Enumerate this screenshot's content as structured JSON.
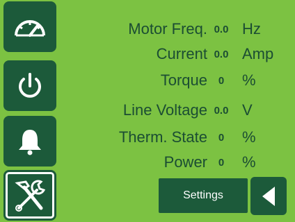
{
  "sidebar": {
    "items": [
      {
        "icon": "speedometer-icon"
      },
      {
        "icon": "power-icon"
      },
      {
        "icon": "bell-icon"
      },
      {
        "icon": "tools-icon",
        "selected": true
      }
    ]
  },
  "readings": [
    {
      "label": "Motor Freq.",
      "value": "0.0",
      "unit": "Hz"
    },
    {
      "label": "Current",
      "value": "0.0",
      "unit": "Amp"
    },
    {
      "label": "Torque",
      "value": "0",
      "unit": "%"
    },
    {
      "label": "Line Voltage",
      "value": "0.0",
      "unit": "V"
    },
    {
      "label": "Therm. State",
      "value": "0",
      "unit": "%"
    },
    {
      "label": "Power",
      "value": "0",
      "unit": "%"
    }
  ],
  "footer": {
    "settings_label": "Settings",
    "back_icon": "triangle-left-icon"
  },
  "colors": {
    "background": "#7cc242",
    "button": "#1c5a3a",
    "text": "#1b4d33",
    "accent_white": "#ffffff"
  }
}
